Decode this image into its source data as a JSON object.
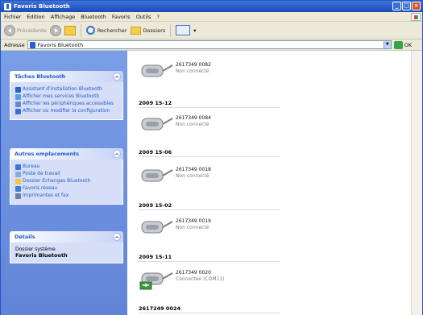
{
  "window": {
    "title": "Favoris Bluetooth"
  },
  "menu": {
    "items": [
      "Fichier",
      "Edition",
      "Affichage",
      "Bluetooth",
      "Favoris",
      "Outils",
      "?"
    ]
  },
  "toolbar": {
    "back": "Précédente",
    "search": "Rechercher",
    "folders": "Dossiers"
  },
  "address": {
    "label": "Adresse",
    "value": "Favoris Bluetooth",
    "go": "OK"
  },
  "taskpane": {
    "bluetooth_tasks": {
      "title": "Tâches Bluetooth",
      "items": [
        "Assistant d'installation Bluetooth",
        "Afficher mes services Bluetooth",
        "Afficher les périphériques accessibles",
        "Afficher ou modifier la configuration"
      ]
    },
    "other_places": {
      "title": "Autres emplacements",
      "items": [
        "Bureau",
        "Poste de travail",
        "Dossier Echanges Bluetooth",
        "Favoris réseau",
        "Imprimantes et fax"
      ]
    },
    "details": {
      "title": "Détails",
      "name": "Favoris Bluetooth",
      "type": "Dossier système"
    }
  },
  "content": {
    "groups": [
      {
        "header": "",
        "devices": [
          {
            "name": "2617349 0082",
            "status": "Non connecté",
            "connected": false
          }
        ]
      },
      {
        "header": "2009 15-12",
        "devices": [
          {
            "name": "2617349 0084",
            "status": "Non connecté",
            "connected": false
          }
        ]
      },
      {
        "header": "2009 15-06",
        "devices": [
          {
            "name": "2617349 0018",
            "status": "Non connecté",
            "connected": false
          }
        ]
      },
      {
        "header": "2009 15-02",
        "devices": [
          {
            "name": "2617349 0019",
            "status": "Non connecté",
            "connected": false
          }
        ]
      },
      {
        "header": "2009 15-11",
        "devices": [
          {
            "name": "2617349 0020",
            "status": "Connectée (COM11)",
            "connected": true
          }
        ]
      },
      {
        "header": "2617249 0024",
        "devices": []
      }
    ]
  }
}
